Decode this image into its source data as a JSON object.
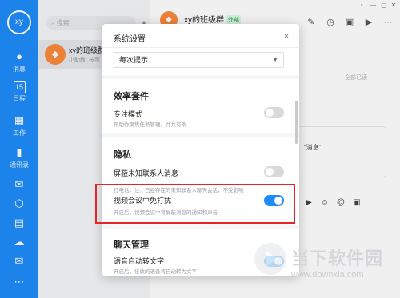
{
  "user": {
    "avatar_text": "xy"
  },
  "nav": [
    {
      "key": "messages",
      "label": "消息",
      "icon": "chat-bubble-icon",
      "glyph": "●"
    },
    {
      "key": "calendar",
      "label": "日程",
      "icon": "calendar-icon",
      "glyph": "15"
    },
    {
      "key": "work",
      "label": "工作",
      "icon": "apps-grid-icon",
      "glyph": "▦"
    },
    {
      "key": "contacts",
      "label": "通讯录",
      "icon": "contacts-icon",
      "glyph": "▮"
    }
  ],
  "nav_extra_icons": [
    "drive-icon",
    "cube-icon",
    "document-icon",
    "cloud-icon",
    "mail-icon",
    "more-icon"
  ],
  "session_list": {
    "search_placeholder": "搜索",
    "add_glyph": "+",
    "items": [
      {
        "avatar_icon": "group-icon",
        "name": "xy的班级群",
        "preview": "小助教: 按票"
      }
    ]
  },
  "chat": {
    "title": "xy的班级群",
    "badge": "外部",
    "read_all": "全部已读",
    "bubble_text": "“消息”",
    "window_controls": [
      "▫",
      "—",
      "▢",
      "✕"
    ],
    "header_icons": [
      "pin-icon",
      "user-add-icon",
      "clock-icon",
      "calendar-icon",
      "video-icon",
      "more-icon"
    ],
    "toolbar_icons": [
      "video-call-icon",
      "emoji-icon",
      "mention-icon",
      "send-file-icon"
    ]
  },
  "dialog": {
    "title": "系统设置",
    "close_glyph": "×",
    "notify_select": "每次提示",
    "sections": {
      "efficiency": {
        "heading": "效率套件",
        "focus_mode": {
          "title": "专注模式",
          "desc": "帮助你聚焦任务管理，并共有条",
          "enabled": false
        }
      },
      "privacy": {
        "heading": "隐私",
        "block_unknown": {
          "title": "屏蔽未知联系人消息",
          "desc": "打电话。注：已经存在的未知联系人聊天会话，不受影响",
          "enabled": false
        },
        "video_no_disturb": {
          "title": "视频会议中免打扰",
          "desc": "开启后，视频会议中将屏蔽消息的通知和声音",
          "enabled": true
        }
      },
      "chat_manage": {
        "heading": "聊天管理",
        "voice_to_text": {
          "title": "语音自动转文字",
          "desc": "开启后，接收的语音将自动转为文字",
          "enabled": true
        }
      }
    }
  },
  "watermark": {
    "brand": "当下软件园",
    "url": "www.downxia.com"
  },
  "colors": {
    "accent": "#1d8cf8",
    "highlight": "#e8242b",
    "group_avatar": "#fb8a3c"
  }
}
